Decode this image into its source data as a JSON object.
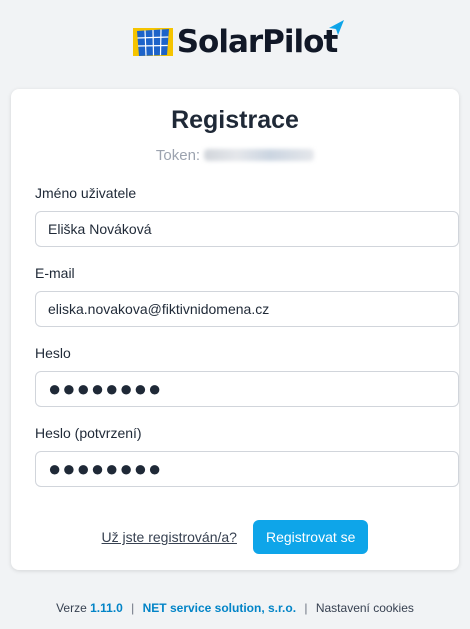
{
  "logo": {
    "text": "SolarPilot"
  },
  "form": {
    "title": "Registrace",
    "token_label": "Token:",
    "fields": [
      {
        "label": "Jméno uživatele",
        "value": "Eliška Nováková"
      },
      {
        "label": "E-mail",
        "value": "eliska.novakova@fiktivnidomena.cz"
      },
      {
        "label": "Heslo",
        "value": "●●●●●●●●"
      },
      {
        "label": "Heslo (potvrzení)",
        "value": "●●●●●●●●"
      }
    ],
    "login_link": "Už jste registrován/a?",
    "submit_label": "Registrovat se"
  },
  "footer": {
    "version_label": "Verze",
    "version": "1.11.0",
    "company": "NET service solution, s.r.o.",
    "cookies": "Nastavení cookies"
  },
  "colors": {
    "accent": "#0ea5e9",
    "link_accent": "#0284c7",
    "background": "#f1f3f5",
    "logo_yellow": "#f5c400",
    "logo_blue": "#1d63c9"
  },
  "icons": [
    "solar-panel-icon",
    "paper-plane-icon"
  ]
}
